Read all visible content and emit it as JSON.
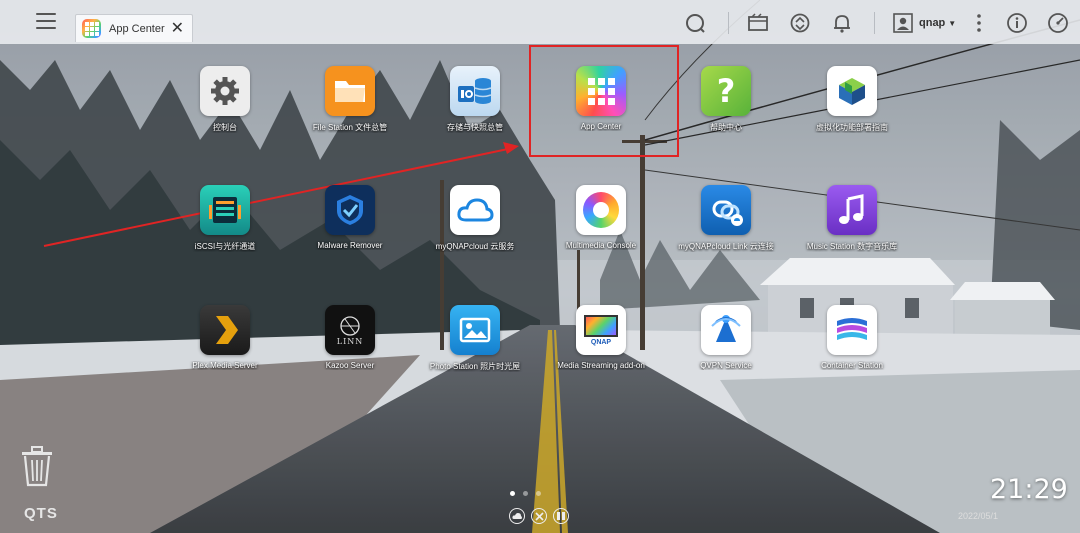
{
  "taskbar": {
    "tab_title": "App Center",
    "user_name": "qnap"
  },
  "apps": [
    {
      "id": "control-panel",
      "label": "控制台",
      "icon": "gear-icon",
      "color": "#eeeeee"
    },
    {
      "id": "file-station",
      "label": "File Station 文件总管",
      "icon": "folder-icon",
      "color": "#f6921e"
    },
    {
      "id": "storage",
      "label": "存储与快照总管",
      "icon": "storage-icon",
      "color": "#2a86d6"
    },
    {
      "id": "app-center",
      "label": "App Center",
      "icon": "app-grid-icon",
      "color": "#ff6a3d"
    },
    {
      "id": "help-center",
      "label": "帮助中心",
      "icon": "question-icon",
      "color": "#7bc043"
    },
    {
      "id": "virtualization",
      "label": "虚拟化功能部署指南",
      "icon": "cube-icon",
      "color": "#ffffff"
    },
    {
      "id": "iscsi",
      "label": "iSCSI与光纤通道",
      "icon": "iscsi-icon",
      "color": "#1fb6a8"
    },
    {
      "id": "malware-remover",
      "label": "Malware Remover",
      "icon": "shield-icon",
      "color": "#123a6e"
    },
    {
      "id": "myqnapcloud",
      "label": "myQNAPcloud 云服务",
      "icon": "cloud-icon",
      "color": "#ffffff"
    },
    {
      "id": "multimedia-console",
      "label": "Multimedia Console",
      "icon": "multimedia-icon",
      "color": "#ffffff"
    },
    {
      "id": "myqnapcloud-link",
      "label": "myQNAPcloud Link 云连接",
      "icon": "cloud-link-icon",
      "color": "#1c77d2"
    },
    {
      "id": "music-station",
      "label": "Music Station 数字音乐库",
      "icon": "music-note-icon",
      "color": "#7d3fd1"
    },
    {
      "id": "plex",
      "label": "Plex Media Server",
      "icon": "plex-icon",
      "color": "#2b2b2b"
    },
    {
      "id": "kazoo",
      "label": "Kazoo Server",
      "icon": "linn-icon",
      "color": "#111111",
      "icon_text": "LINN"
    },
    {
      "id": "photo-station",
      "label": "Photo Station 照片时光屋",
      "icon": "photo-icon",
      "color": "#1e9be0"
    },
    {
      "id": "media-streaming",
      "label": "Media Streaming add-on",
      "icon": "qnap-streaming-icon",
      "color": "#ffffff",
      "icon_text": "QNAP"
    },
    {
      "id": "qvpn",
      "label": "QVPN Service",
      "icon": "vpn-icon",
      "color": "#ffffff"
    },
    {
      "id": "container-station",
      "label": "Container Station",
      "icon": "container-icon",
      "color": "#ffffff"
    }
  ],
  "desktop": {
    "brand": "QTS",
    "time": "21:29",
    "date": "2022/05/1"
  },
  "colors": {
    "highlight": "#e02424",
    "arrow": "#e02424"
  }
}
